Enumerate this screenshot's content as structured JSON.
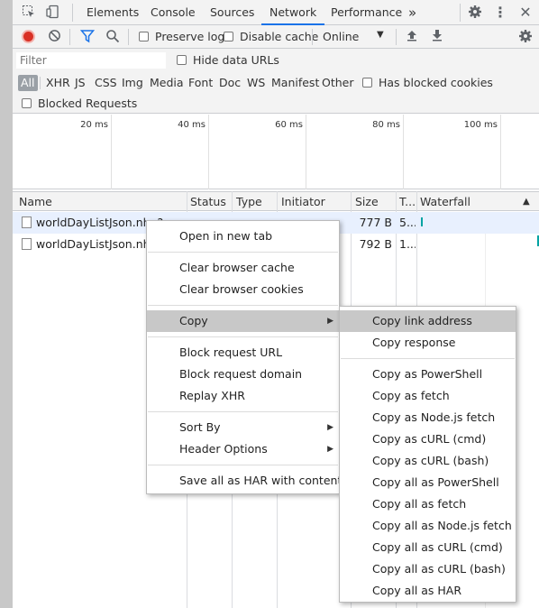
{
  "tabs": {
    "elements": "Elements",
    "console": "Console",
    "sources": "Sources",
    "network": "Network",
    "performance": "Performance",
    "more": "»"
  },
  "toolbar": {
    "preserve_log": "Preserve log",
    "disable_cache": "Disable cache",
    "throttle": "Online"
  },
  "filter": {
    "placeholder": "Filter",
    "hide_data_urls": "Hide data URLs",
    "types": [
      "All",
      "XHR",
      "JS",
      "CSS",
      "Img",
      "Media",
      "Font",
      "Doc",
      "WS",
      "Manifest",
      "Other"
    ],
    "has_blocked_cookies": "Has blocked cookies",
    "blocked_requests": "Blocked Requests"
  },
  "overview": {
    "ticks": [
      "20 ms",
      "40 ms",
      "60 ms",
      "80 ms",
      "100 ms"
    ]
  },
  "table": {
    "headers": {
      "name": "Name",
      "status": "Status",
      "type": "Type",
      "initiator": "Initiator",
      "size": "Size",
      "time": "T...",
      "waterfall": "Waterfall"
    },
    "rows": [
      {
        "name": "worldDayListJson.nhn?s...",
        "size": "777 B",
        "time": "5..."
      },
      {
        "name": "worldDayListJson.nhn?s...",
        "size": "792 B",
        "time": "1..."
      }
    ]
  },
  "context_menu": {
    "open_new_tab": "Open in new tab",
    "clear_cache": "Clear browser cache",
    "clear_cookies": "Clear browser cookies",
    "copy": "Copy",
    "block_url": "Block request URL",
    "block_domain": "Block request domain",
    "replay_xhr": "Replay XHR",
    "sort_by": "Sort By",
    "header_options": "Header Options",
    "save_har": "Save all as HAR with content"
  },
  "copy_submenu": {
    "link_address": "Copy link address",
    "response": "Copy response",
    "as_powershell": "Copy as PowerShell",
    "as_fetch": "Copy as fetch",
    "as_node_fetch": "Copy as Node.js fetch",
    "as_curl_cmd": "Copy as cURL (cmd)",
    "as_curl_bash": "Copy as cURL (bash)",
    "all_powershell": "Copy all as PowerShell",
    "all_fetch": "Copy all as fetch",
    "all_node_fetch": "Copy all as Node.js fetch",
    "all_curl_cmd": "Copy all as cURL (cmd)",
    "all_curl_bash": "Copy all as cURL (bash)",
    "all_har": "Copy all as HAR"
  },
  "colors": {
    "record": "#d93025",
    "accent": "#1a73e8",
    "waterfall_bar": "#00a3a3"
  }
}
